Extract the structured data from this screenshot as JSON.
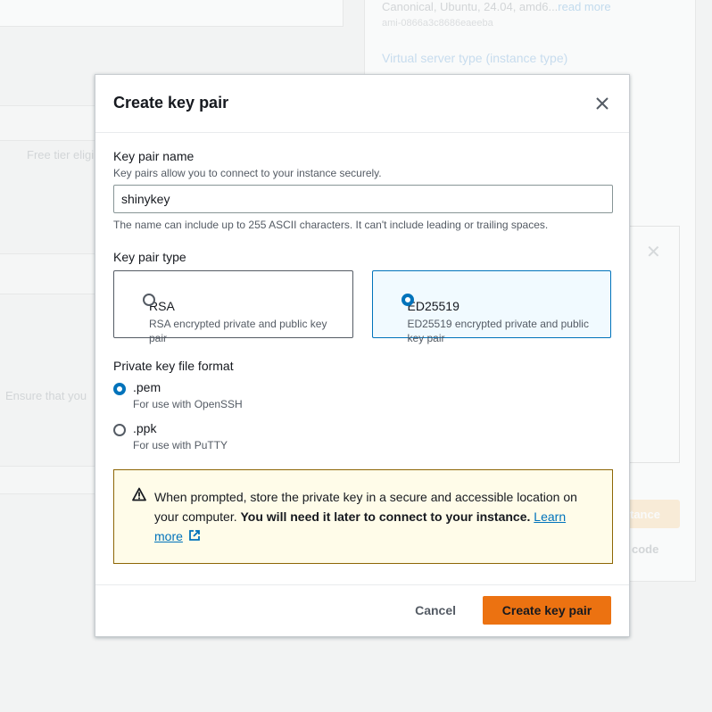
{
  "background": {
    "ami_summary": "Canonical, Ubuntu, 24.04, amd6...",
    "read_more": "read more",
    "ami_id": "ami-0866a3c8686eaeeba",
    "instance_type_heading": "Virtual server type (instance type)",
    "free_tier": "Free tier eligi",
    "ensure_text": "Ensure that you",
    "launch_fragment": "tance",
    "code_fragment": "code"
  },
  "modal": {
    "title": "Create key pair",
    "close_icon": "close-icon",
    "key_name": {
      "label": "Key pair name",
      "description": "Key pairs allow you to connect to your instance securely.",
      "value": "shinykey",
      "constraint": "The name can include up to 255 ASCII characters. It can't include leading or trailing spaces."
    },
    "key_type": {
      "label": "Key pair type",
      "options": [
        {
          "label": "RSA",
          "description": "RSA encrypted private and public key pair",
          "selected": false
        },
        {
          "label": "ED25519",
          "description": "ED25519 encrypted private and public key pair",
          "selected": true
        }
      ]
    },
    "file_format": {
      "label": "Private key file format",
      "options": [
        {
          "label": ".pem",
          "description": "For use with OpenSSH",
          "selected": true
        },
        {
          "label": ".ppk",
          "description": "For use with PuTTY",
          "selected": false
        }
      ]
    },
    "alert": {
      "icon": "warning-icon",
      "text": "When prompted, store the private key in a secure and accessible location on your computer.",
      "bold_text": "You will need it later to connect to your instance.",
      "link_text_1": "Learn",
      "link_text_2": "more",
      "link_icon": "external-link-icon"
    },
    "footer": {
      "cancel_label": "Cancel",
      "create_label": "Create key pair"
    }
  },
  "colors": {
    "accent": "#0073bb",
    "primary_button": "#ec7211",
    "warning_border": "#8d6605",
    "warning_bg": "#fffce9"
  }
}
